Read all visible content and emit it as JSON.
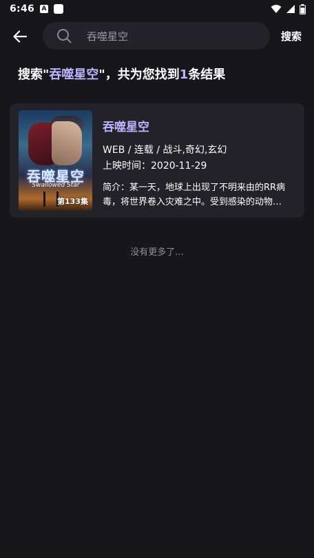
{
  "status_bar": {
    "time": "6:46",
    "notification_icons": [
      "a-icon",
      "square-icon"
    ],
    "right_icons": [
      "wifi-icon",
      "cellular-icon",
      "battery-icon"
    ]
  },
  "search": {
    "query": "吞噬星空",
    "button_label": "搜索"
  },
  "summary": {
    "prefix": "搜索\"",
    "keyword": "吞噬星空",
    "middle": "\"，共为您找到",
    "count": "1",
    "suffix": "条结果"
  },
  "results": [
    {
      "title": "吞噬星空",
      "poster_title": "吞噬星空",
      "poster_subtitle": "Swallowed Star",
      "episode_badge": "第133集",
      "meta": "WEB / 连载 / 战斗,奇幻,玄幻",
      "release": "上映时间：2020-11-29",
      "description": "简介：某一天，地球上出现了不明来由的RR病毒，将世界卷入灾难之中。受到感染的动物们变异成为凶猛的怪兽，人类文明遭受重创。"
    }
  ],
  "footer": {
    "no_more": "没有更多了..."
  },
  "colors": {
    "background": "#16161b",
    "card": "#222228",
    "search_box": "#232329",
    "accent": "#b9b4ff",
    "muted": "#8e8e96"
  }
}
